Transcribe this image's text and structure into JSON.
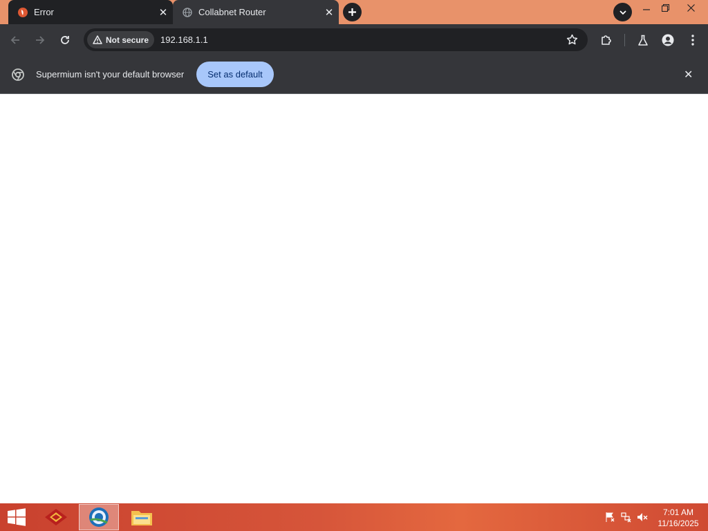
{
  "browser": {
    "tabs": [
      {
        "title": "Error",
        "close": "✕"
      },
      {
        "title": "Collabnet Router",
        "close": "✕"
      }
    ],
    "security_chip": "Not secure",
    "url": "192.168.1.1"
  },
  "infobar": {
    "message": "Supermium isn't your default browser",
    "button": "Set as default",
    "close": "✕"
  },
  "taskbar": {
    "time": "7:01 AM",
    "date": "11/16/2025"
  },
  "colors": {
    "titlebar": "#e8926a",
    "toolbar": "#35363a",
    "accent_button": "#a8c7fa"
  }
}
